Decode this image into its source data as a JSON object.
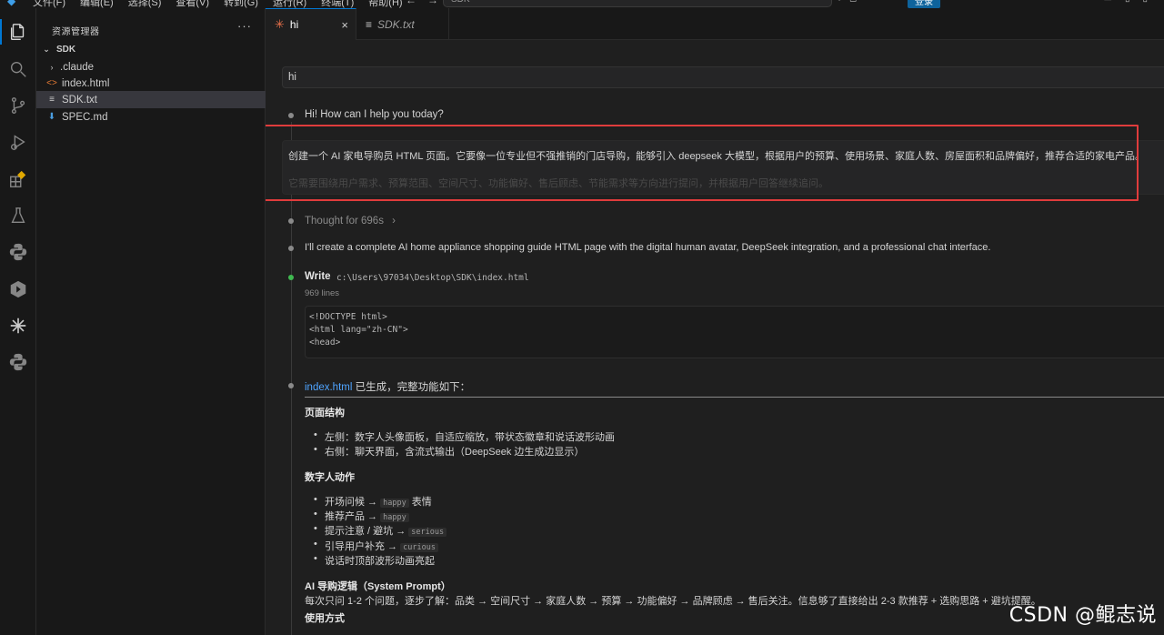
{
  "titlebar": {
    "menus": [
      "文件(F)",
      "编辑(E)",
      "选择(S)",
      "查看(V)",
      "转到(G)",
      "运行(R)",
      "终端(T)",
      "帮助(H)"
    ],
    "search_text": "SDK",
    "login_label": "登录"
  },
  "explorer": {
    "header": "资源管理器",
    "more": "···",
    "root": "SDK",
    "items": [
      {
        "name": ".claude",
        "type": "folder"
      },
      {
        "name": "index.html",
        "type": "html"
      },
      {
        "name": "SDK.txt",
        "type": "text",
        "selected": true
      },
      {
        "name": "SPEC.md",
        "type": "markdown"
      }
    ]
  },
  "tabs": [
    {
      "label": "hi",
      "active": true,
      "close": "×"
    },
    {
      "label": "SDK.txt",
      "active": false
    }
  ],
  "chat": {
    "user_prompt_1": "hi",
    "reply_1": "Hi! How can I help you today?",
    "user_prompt_2_line1": "创建一个 AI 家电导购员 HTML 页面。它要像一位专业但不强推销的门店导购，能够引入 deepseek 大模型，根据用户的预算、使用场景、家庭人数、房屋面积和品牌偏好，推荐合适的家电产品。",
    "user_prompt_2_line2": "它需要围绕用户需求、预算范围、空间尺寸、功能偏好、售后顾虑、节能需求等方向进行提问，并根据用户回答继续追问。",
    "thought": "Thought for 696s",
    "thought_chevron": "›",
    "reply_2": "I'll create a complete AI home appliance shopping guide HTML page with the digital human avatar, DeepSeek integration, and a professional chat interface.",
    "write_label": "Write",
    "write_path": "c:\\Users\\97034\\Desktop\\SDK\\index.html",
    "write_lines": "969 lines",
    "code_lines": [
      "<!DOCTYPE html>",
      "<html lang=\"zh-CN\">",
      "<head>"
    ],
    "summary_link": "index.html",
    "summary_text": " 已生成，完整功能如下：",
    "section1_title": "页面结构",
    "section1_items": [
      "左侧：数字人头像面板，自适应缩放，带状态徽章和说话波形动画",
      "右侧：聊天界面，含流式输出（DeepSeek 边生成边显示）"
    ],
    "section2_title": "数字人动作",
    "section2_items": [
      {
        "text": "开场问候 → ",
        "tag": "happy",
        "suffix": " 表情"
      },
      {
        "text": "推荐产品 → ",
        "tag": "happy",
        "suffix": ""
      },
      {
        "text": "提示注意 / 避坑 → ",
        "tag": "serious",
        "suffix": ""
      },
      {
        "text": "引导用户补充 → ",
        "tag": "curious",
        "suffix": ""
      },
      {
        "text": "说话时顶部波形动画亮起",
        "tag": "",
        "suffix": ""
      }
    ],
    "section3_title": "AI 导购逻辑（System Prompt）",
    "section3_text": "每次只问 1-2 个问题，逐步了解：品类 → 空间尺寸 → 家庭人数 → 预算 → 功能偏好 → 品牌顾虑 → 售后关注。信息够了直接给出 2-3 款推荐 + 选购思路 + 避坑提醒。",
    "section4_title": "使用方式"
  },
  "watermark": "CSDN @鲲志说",
  "colors": {
    "accent": "#0078d4",
    "highlight_border": "#e03c3c",
    "link": "#4fa4ff",
    "success_dot": "#3fb950"
  }
}
